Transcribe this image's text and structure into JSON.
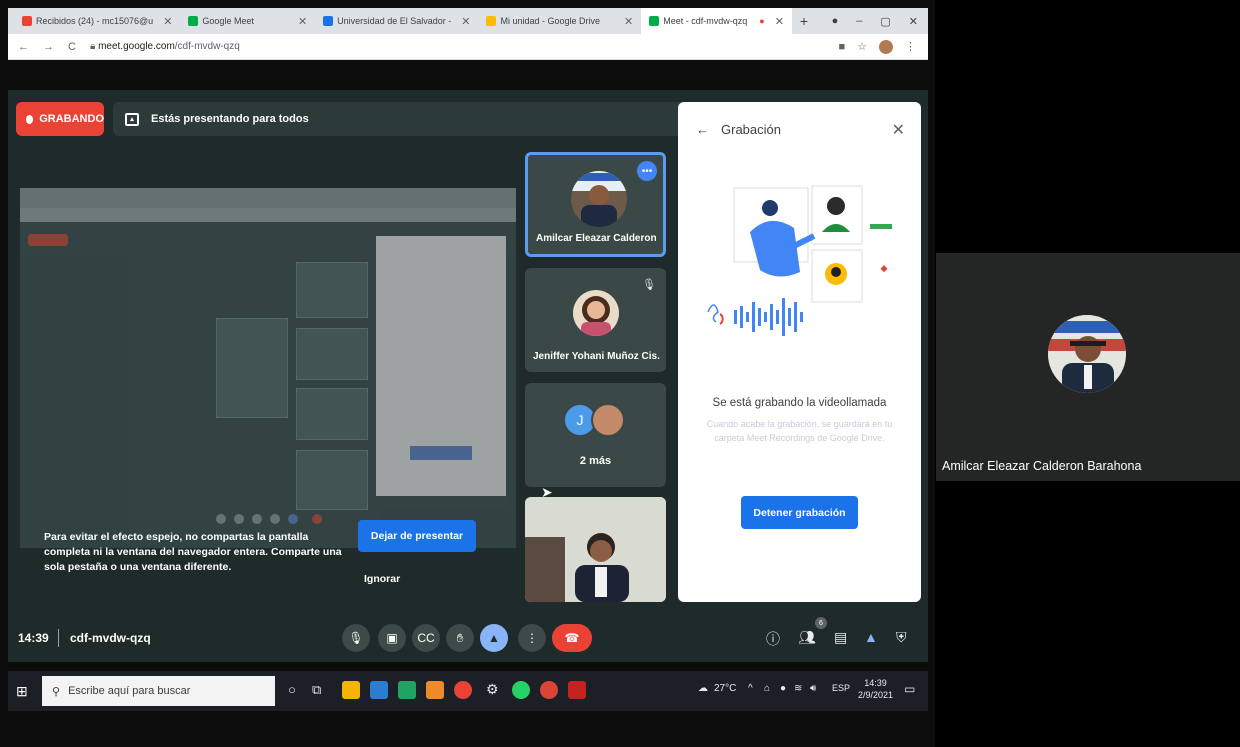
{
  "browser": {
    "tabs": [
      {
        "label": "Recibidos (24) - mc15076@u",
        "color": "#ea4335"
      },
      {
        "label": "Google Meet",
        "color": "#00ac47"
      },
      {
        "label": "Universidad de El Salvador -",
        "color": "#1a73e8"
      },
      {
        "label": "Mi unidad - Google Drive",
        "color": "#fbbc04"
      },
      {
        "label": "Meet - cdf-mvdw-qzq",
        "color": "#00ac47"
      }
    ],
    "new_tab": "+",
    "url_domain": "meet.google.com",
    "url_path": "/cdf-mvdw-qzq"
  },
  "meet": {
    "recording_label": "GRABANDO",
    "presenting_label": "Estás presentando para todos",
    "participants": [
      {
        "name": "Amilcar Eleazar Calderon ..."
      },
      {
        "name": "Jeniffer Yohani Muñoz Cis..."
      },
      {
        "initial": "J",
        "count_label": "2 más"
      }
    ],
    "warning": "Para evitar el efecto espejo, no compartas la pantalla completa ni la ventana del navegador entera. Comparte una sola pestaña o una ventana diferente.",
    "stop_present": "Dejar de presentar",
    "ignore": "Ignorar",
    "time": "14:39",
    "meeting_code": "cdf-mvdw-qzq",
    "participant_badge": "6"
  },
  "recording_panel": {
    "title": "Grabación",
    "status": "Se está grabando la videollamada",
    "description": "Cuando acabe la grabación, se guardará en tu carpeta Meet Recordings de Google Drive.",
    "stop_button": "Detener grabación"
  },
  "taskbar": {
    "search_placeholder": "Escribe aquí para buscar",
    "temperature": "27°C",
    "language": "ESP",
    "clock_time": "14:39",
    "clock_date": "2/9/2021"
  },
  "presenter": {
    "name": "Amilcar Eleazar Calderon Barahona"
  }
}
